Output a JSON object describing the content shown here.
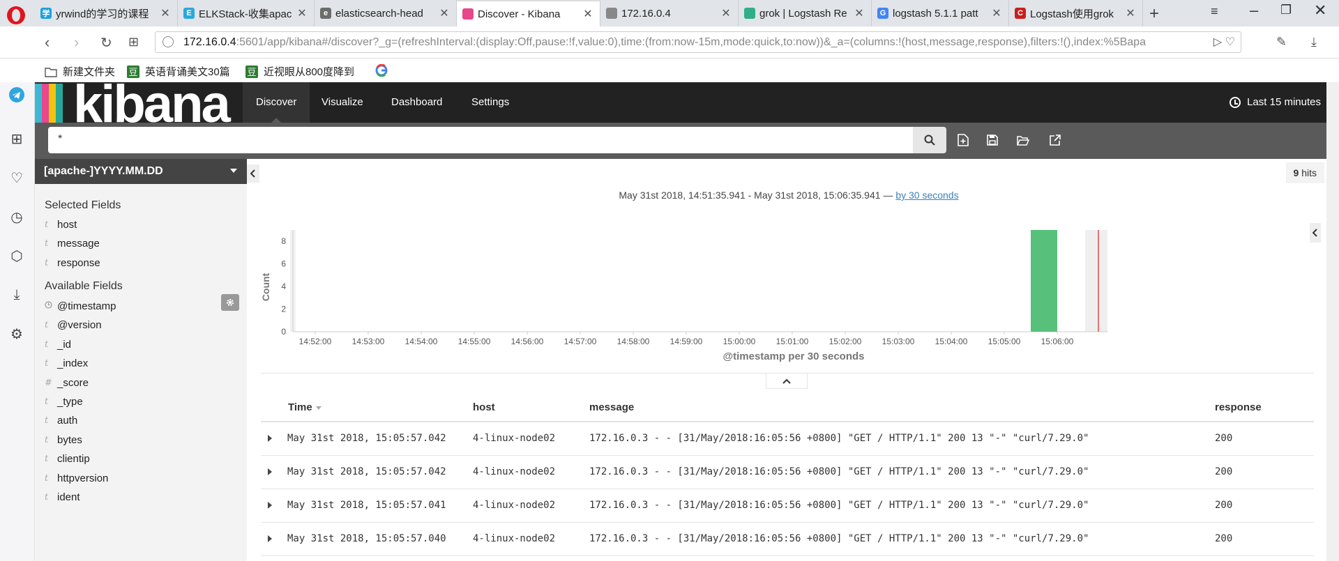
{
  "browser": {
    "tabs": [
      {
        "title": "yrwind的学习的课程",
        "fav_color": "#1aa1e0",
        "fav_glyph": "学",
        "active": false
      },
      {
        "title": "ELKStack-收集apac",
        "fav_color": "#29a8e0",
        "fav_glyph": "E",
        "active": false
      },
      {
        "title": "elasticsearch-head",
        "fav_color": "#6c6c6c",
        "fav_glyph": "e",
        "active": false
      },
      {
        "title": "Discover - Kibana",
        "fav_color": "#e8478b",
        "fav_glyph": "",
        "active": true
      },
      {
        "title": "172.16.0.4",
        "fav_color": "#888888",
        "fav_glyph": "",
        "active": false
      },
      {
        "title": "grok | Logstash Re",
        "fav_color": "#2eaf8a",
        "fav_glyph": "",
        "active": false
      },
      {
        "title": "logstash 5.1.1 patt",
        "fav_color": "#4285f4",
        "fav_glyph": "G",
        "active": false
      },
      {
        "title": "Logstash使用grok",
        "fav_color": "#c81e1e",
        "fav_glyph": "C",
        "active": false
      }
    ],
    "url_host": "172.16.0.4",
    "url_rest": ":5601/app/kibana#/discover?_g=(refreshInterval:(display:Off,pause:!f,value:0),time:(from:now-15m,mode:quick,to:now))&_a=(columns:!(host,message,response),filters:!(),index:%5Bapa",
    "bookmarks": [
      {
        "label": "新建文件夹",
        "icon": "folder-icon"
      },
      {
        "label": "英语背诵美文30篇",
        "icon": "douban-icon"
      },
      {
        "label": "近视眼从800度降到",
        "icon": "douban-icon"
      },
      {
        "label": "",
        "icon": "google-icon"
      }
    ]
  },
  "kibana": {
    "nav_tabs": [
      "Discover",
      "Visualize",
      "Dashboard",
      "Settings"
    ],
    "time_picker": "Last 15 minutes",
    "query": "*",
    "index_pattern": "[apache-]YYYY.MM.DD",
    "selected_fields_title": "Selected Fields",
    "selected_fields": [
      {
        "type": "t",
        "name": "host"
      },
      {
        "type": "t",
        "name": "message"
      },
      {
        "type": "t",
        "name": "response"
      }
    ],
    "available_fields_title": "Available Fields",
    "available_fields": [
      {
        "type": "clock",
        "name": "@timestamp"
      },
      {
        "type": "t",
        "name": "@version"
      },
      {
        "type": "t",
        "name": "_id"
      },
      {
        "type": "t",
        "name": "_index"
      },
      {
        "type": "#",
        "name": "_score"
      },
      {
        "type": "t",
        "name": "_type"
      },
      {
        "type": "t",
        "name": "auth"
      },
      {
        "type": "t",
        "name": "bytes"
      },
      {
        "type": "t",
        "name": "clientip"
      },
      {
        "type": "t",
        "name": "httpversion"
      },
      {
        "type": "t",
        "name": "ident"
      }
    ],
    "hits_count": "9",
    "hits_label": "hits",
    "time_range": "May 31st 2018, 14:51:35.941 - May 31st 2018, 15:06:35.941 —",
    "interval_link": "by 30 seconds",
    "table": {
      "columns": [
        "Time",
        "host",
        "message",
        "response"
      ],
      "rows": [
        {
          "time": "May 31st 2018, 15:05:57.042",
          "host": "4-linux-node02",
          "message": "172.16.0.3 - - [31/May/2018:16:05:56 +0800] \"GET / HTTP/1.1\" 200 13 \"-\" \"curl/7.29.0\"",
          "response": "200"
        },
        {
          "time": "May 31st 2018, 15:05:57.042",
          "host": "4-linux-node02",
          "message": "172.16.0.3 - - [31/May/2018:16:05:56 +0800] \"GET / HTTP/1.1\" 200 13 \"-\" \"curl/7.29.0\"",
          "response": "200"
        },
        {
          "time": "May 31st 2018, 15:05:57.041",
          "host": "4-linux-node02",
          "message": "172.16.0.3 - - [31/May/2018:16:05:56 +0800] \"GET / HTTP/1.1\" 200 13 \"-\" \"curl/7.29.0\"",
          "response": "200"
        },
        {
          "time": "May 31st 2018, 15:05:57.040",
          "host": "4-linux-node02",
          "message": "172.16.0.3 - - [31/May/2018:16:05:56 +0800] \"GET / HTTP/1.1\" 200 13 \"-\" \"curl/7.29.0\"",
          "response": "200"
        }
      ]
    }
  },
  "chart_data": {
    "type": "bar",
    "xlabel": "@timestamp per 30 seconds",
    "ylabel": "Count",
    "ylim": [
      0,
      9
    ],
    "yticks": [
      0,
      2,
      4,
      6,
      8
    ],
    "xticks": [
      "14:52:00",
      "14:53:00",
      "14:54:00",
      "14:55:00",
      "14:56:00",
      "14:57:00",
      "14:58:00",
      "14:59:00",
      "15:00:00",
      "15:01:00",
      "15:02:00",
      "15:03:00",
      "15:04:00",
      "15:05:00",
      "15:06:00"
    ],
    "bars": [
      {
        "start": "15:05:30",
        "end": "15:06:00",
        "count": 9
      }
    ],
    "bar_color": "#57c17b",
    "now_marker_color": "#e57373"
  },
  "colors": {
    "kibana_stripes": [
      "#3cb7d4",
      "#e8478b",
      "#f1c40f",
      "#27a79a",
      "#222222"
    ]
  }
}
